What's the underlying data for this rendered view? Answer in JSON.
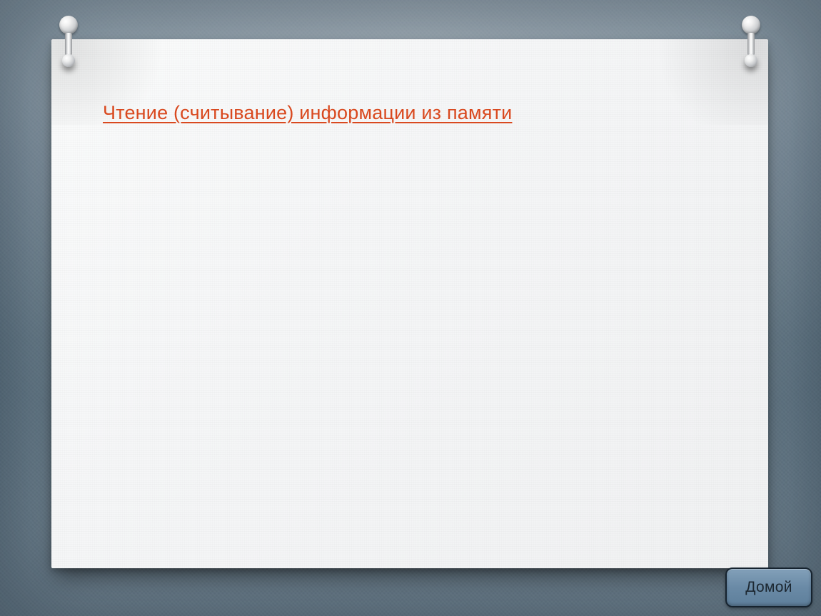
{
  "slide": {
    "title_link": "Чтение (считывание) информации из памяти"
  },
  "nav": {
    "home_label": "Домой"
  }
}
